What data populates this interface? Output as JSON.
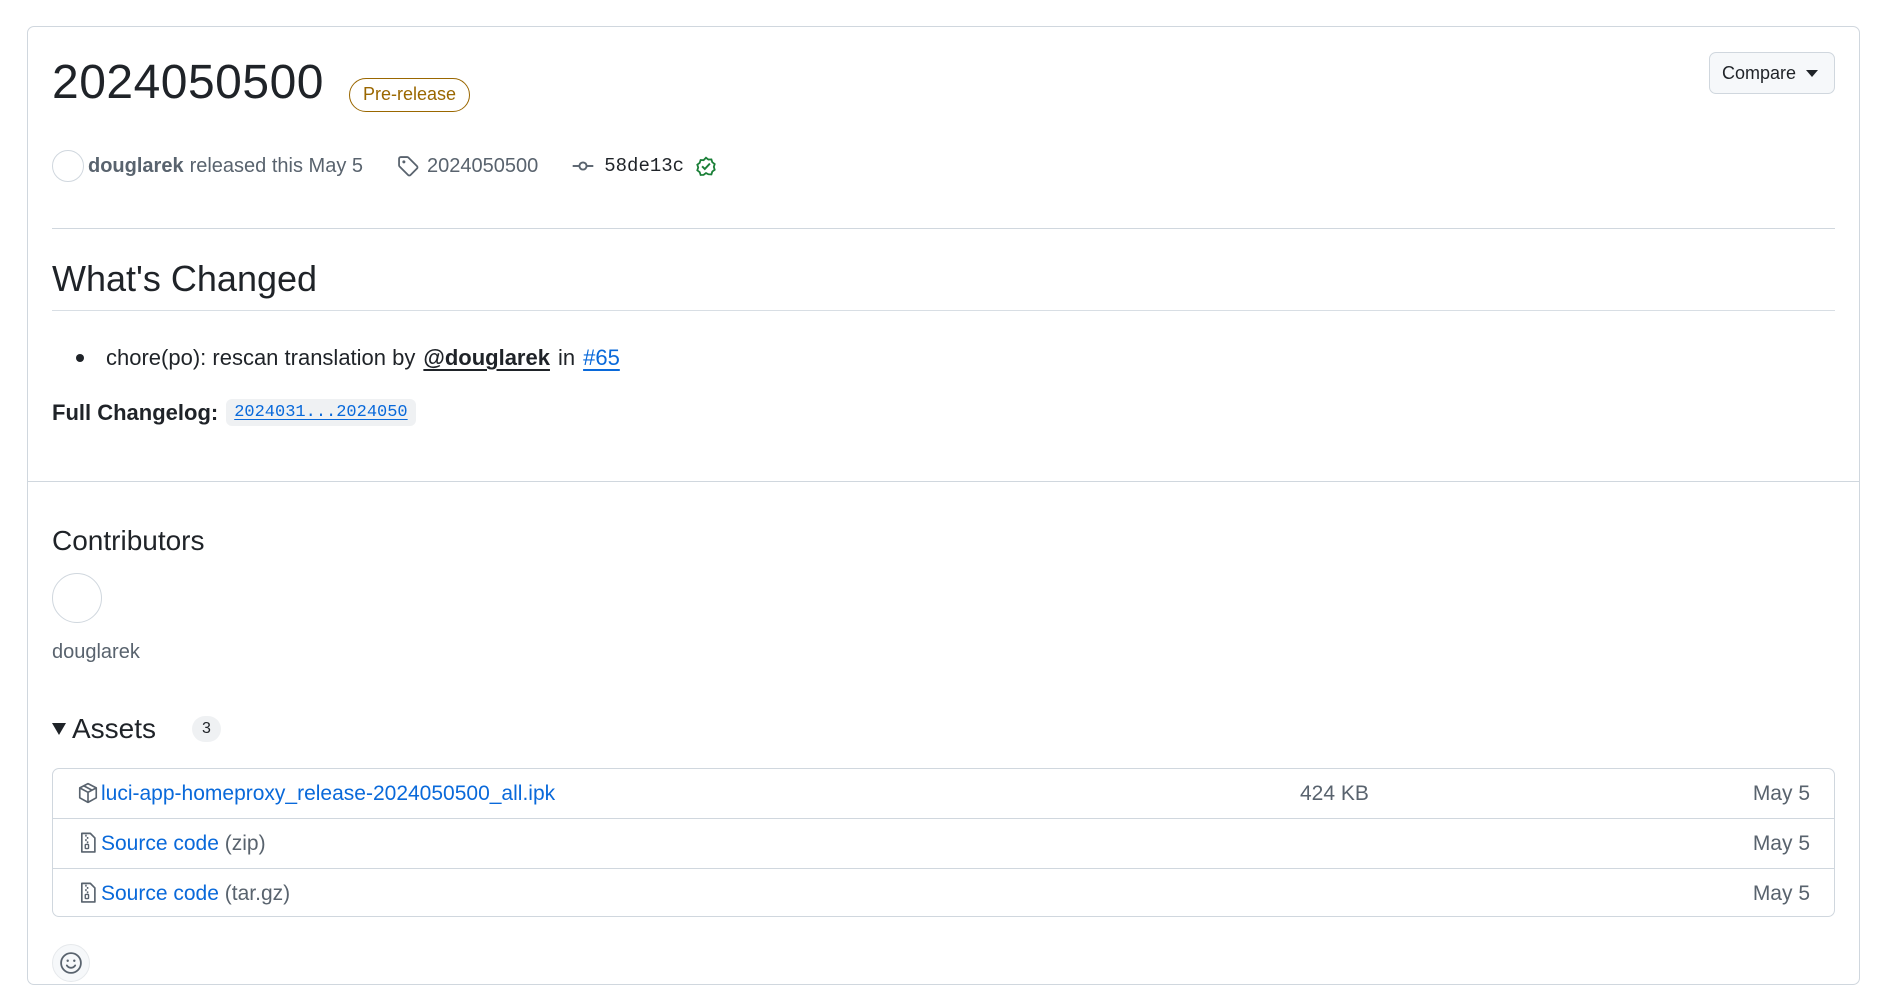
{
  "release": {
    "title": "2024050500",
    "badge": "Pre-release",
    "compare_label": "Compare",
    "author": "douglarek",
    "released_text": "released this May 5",
    "tag": "2024050500",
    "commit": "58de13c"
  },
  "notes": {
    "heading": "What's Changed",
    "bullet_text": "chore(po): rescan translation by",
    "bullet_mention": "@douglarek",
    "bullet_in": "in",
    "bullet_pr": "#65",
    "changelog_label": "Full Changelog:",
    "changelog_range": "2024031...2024050"
  },
  "contributors": {
    "heading": "Contributors",
    "names": [
      "douglarek"
    ]
  },
  "assets": {
    "heading": "Assets",
    "count": "3",
    "items": [
      {
        "name": "luci-app-homeproxy_release-2024050500_all.ipk",
        "suffix": "",
        "size": "424 KB",
        "date": "May 5",
        "icon": "package-icon"
      },
      {
        "name": "Source code",
        "suffix": "(zip)",
        "size": "",
        "date": "May 5",
        "icon": "file-zip-icon"
      },
      {
        "name": "Source code",
        "suffix": "(tar.gz)",
        "size": "",
        "date": "May 5",
        "icon": "file-zip-icon"
      }
    ]
  },
  "colors": {
    "link": "#0969da",
    "prerelease": "#9a6700",
    "verified": "#1a7f37",
    "border": "#d0d7de",
    "muted": "#59636e"
  }
}
